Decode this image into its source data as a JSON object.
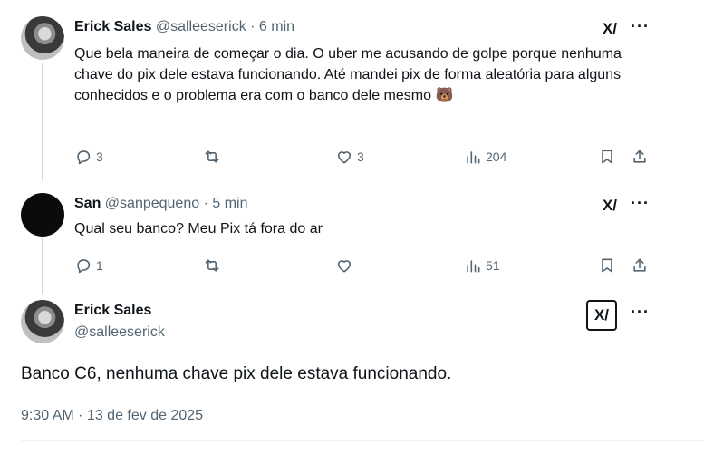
{
  "tweets": [
    {
      "name": "Erick Sales",
      "handle": "@salleeserick",
      "time": "6 min",
      "text": "Que bela maneira de começar o dia. O uber me acusando de golpe porque nenhuma chave do pix dele estava funcionando. Até mandei pix de forma aleatória para alguns conhecidos e o problema era com o banco dele mesmo 🐻",
      "reply_count": "3",
      "retweet_count": "",
      "like_count": "3",
      "view_count": "204"
    },
    {
      "name": "San",
      "handle": "@sanpequeno",
      "time": "5 min",
      "text": "Qual seu banco? Meu Pix tá fora do ar",
      "reply_count": "1",
      "retweet_count": "",
      "like_count": "",
      "view_count": "51"
    }
  ],
  "main_tweet": {
    "name": "Erick Sales",
    "handle": "@salleeserick",
    "text": "Banco C6, nenhuma chave pix dele estava funcionando.",
    "timestamp": "9:30 AM · 13 de fev de 2025"
  },
  "ui": {
    "separator": "·",
    "more_label": "···",
    "grok_label": "X/",
    "icons": [
      "reply-icon",
      "retweet-icon",
      "like-icon",
      "views-icon",
      "bookmark-icon",
      "share-icon",
      "grok-icon",
      "more-icon"
    ]
  }
}
